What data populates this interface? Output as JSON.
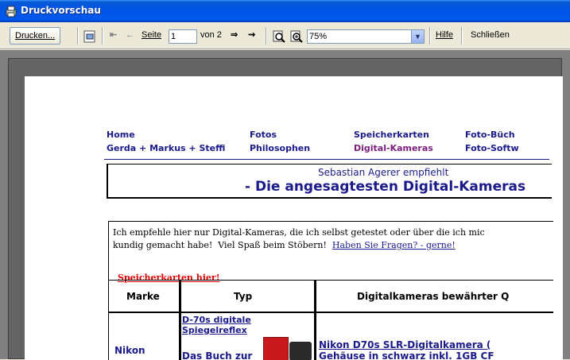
{
  "window": {
    "title": "Druckvorschau"
  },
  "toolbar": {
    "print_label": "Drucken...",
    "page_label": "Seite",
    "page_value": "1",
    "page_of": "von 2",
    "zoom_value": "75%",
    "help_label": "Hilfe",
    "close_label": "Schließen"
  },
  "page": {
    "nav": {
      "row1": [
        "Home",
        "Fotos",
        "Speicherkarten",
        "Foto-Büch"
      ],
      "row2": [
        "Gerda + Markus + Steffi",
        "Philosophen",
        "Digital-Kameras",
        "Foto-Softw"
      ]
    },
    "header": {
      "subtitle": "Sebastian Agerer empfiehlt",
      "title": "- Die angesagtesten Digital-Kameras"
    },
    "intro": {
      "line1": "Ich empfehle hier nur Digital-Kameras, die ich selbst getestet oder über die ich mic",
      "line2_text": "kundig gemacht habe!  Viel Spaß beim Stöbern!  ",
      "line2_link": "Haben Sie Fragen? - gerne!"
    },
    "memory_link": "Speicherkarten hier!",
    "table": {
      "headers": [
        "Marke",
        "Typ",
        "Digitalkameras bewährter Q"
      ],
      "rows": [
        {
          "marke": "Nikon",
          "typ_link_1": "D-70s digitale Spiegelreflex",
          "typ_link_2": "Das Buch zur",
          "desc_line1": "Nikon D70s SLR-Digitalkamera (",
          "desc_line2": "Gehäuse in schwarz inkl. 1GB CF"
        }
      ]
    }
  },
  "colors": {
    "titlebar": "#0054e3",
    "link": "#1a1a8a",
    "visited": "#7a1f7a",
    "red_link": "#e00000"
  }
}
